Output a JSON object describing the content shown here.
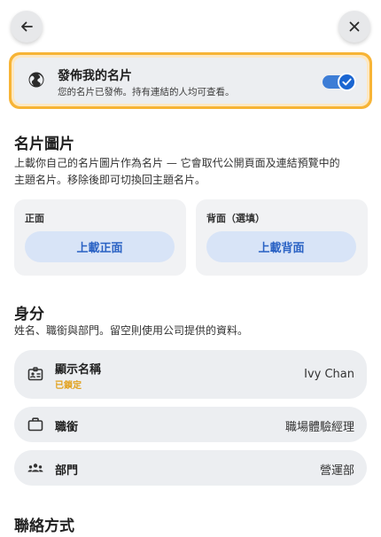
{
  "header": {
    "back_icon": "arrow-left-icon",
    "close_icon": "close-icon"
  },
  "publish": {
    "title": "發佈我的名片",
    "subtitle": "您的名片已發佈。持有連結的人均可查看。",
    "enabled": true,
    "icon": "globe-icon",
    "accent_color": "#f7b436",
    "toggle_color": "#1b66d2"
  },
  "card_image": {
    "title": "名片圖片",
    "description_line1": "上載你自己的名片圖片作為名片 — 它會取代公開頁面及連結預覽中的",
    "description_line2": "主題名片。移除後即可切換回主題名片。",
    "front": {
      "label": "正面",
      "button": "上載正面"
    },
    "back": {
      "label": "背面（選填）",
      "button": "上載背面"
    }
  },
  "identity": {
    "title": "身分",
    "description": "姓名、職銜與部門。留空則使用公司提供的資料。",
    "rows": [
      {
        "label": "顯示名稱",
        "value": "Ivy Chan",
        "status": "已鎖定",
        "icon": "id-card-icon"
      },
      {
        "label": "職銜",
        "value": "職場體驗經理",
        "icon": "briefcase-icon"
      },
      {
        "label": "部門",
        "value": "營運部",
        "icon": "group-icon"
      }
    ]
  },
  "contact": {
    "title": "聯絡方式"
  }
}
